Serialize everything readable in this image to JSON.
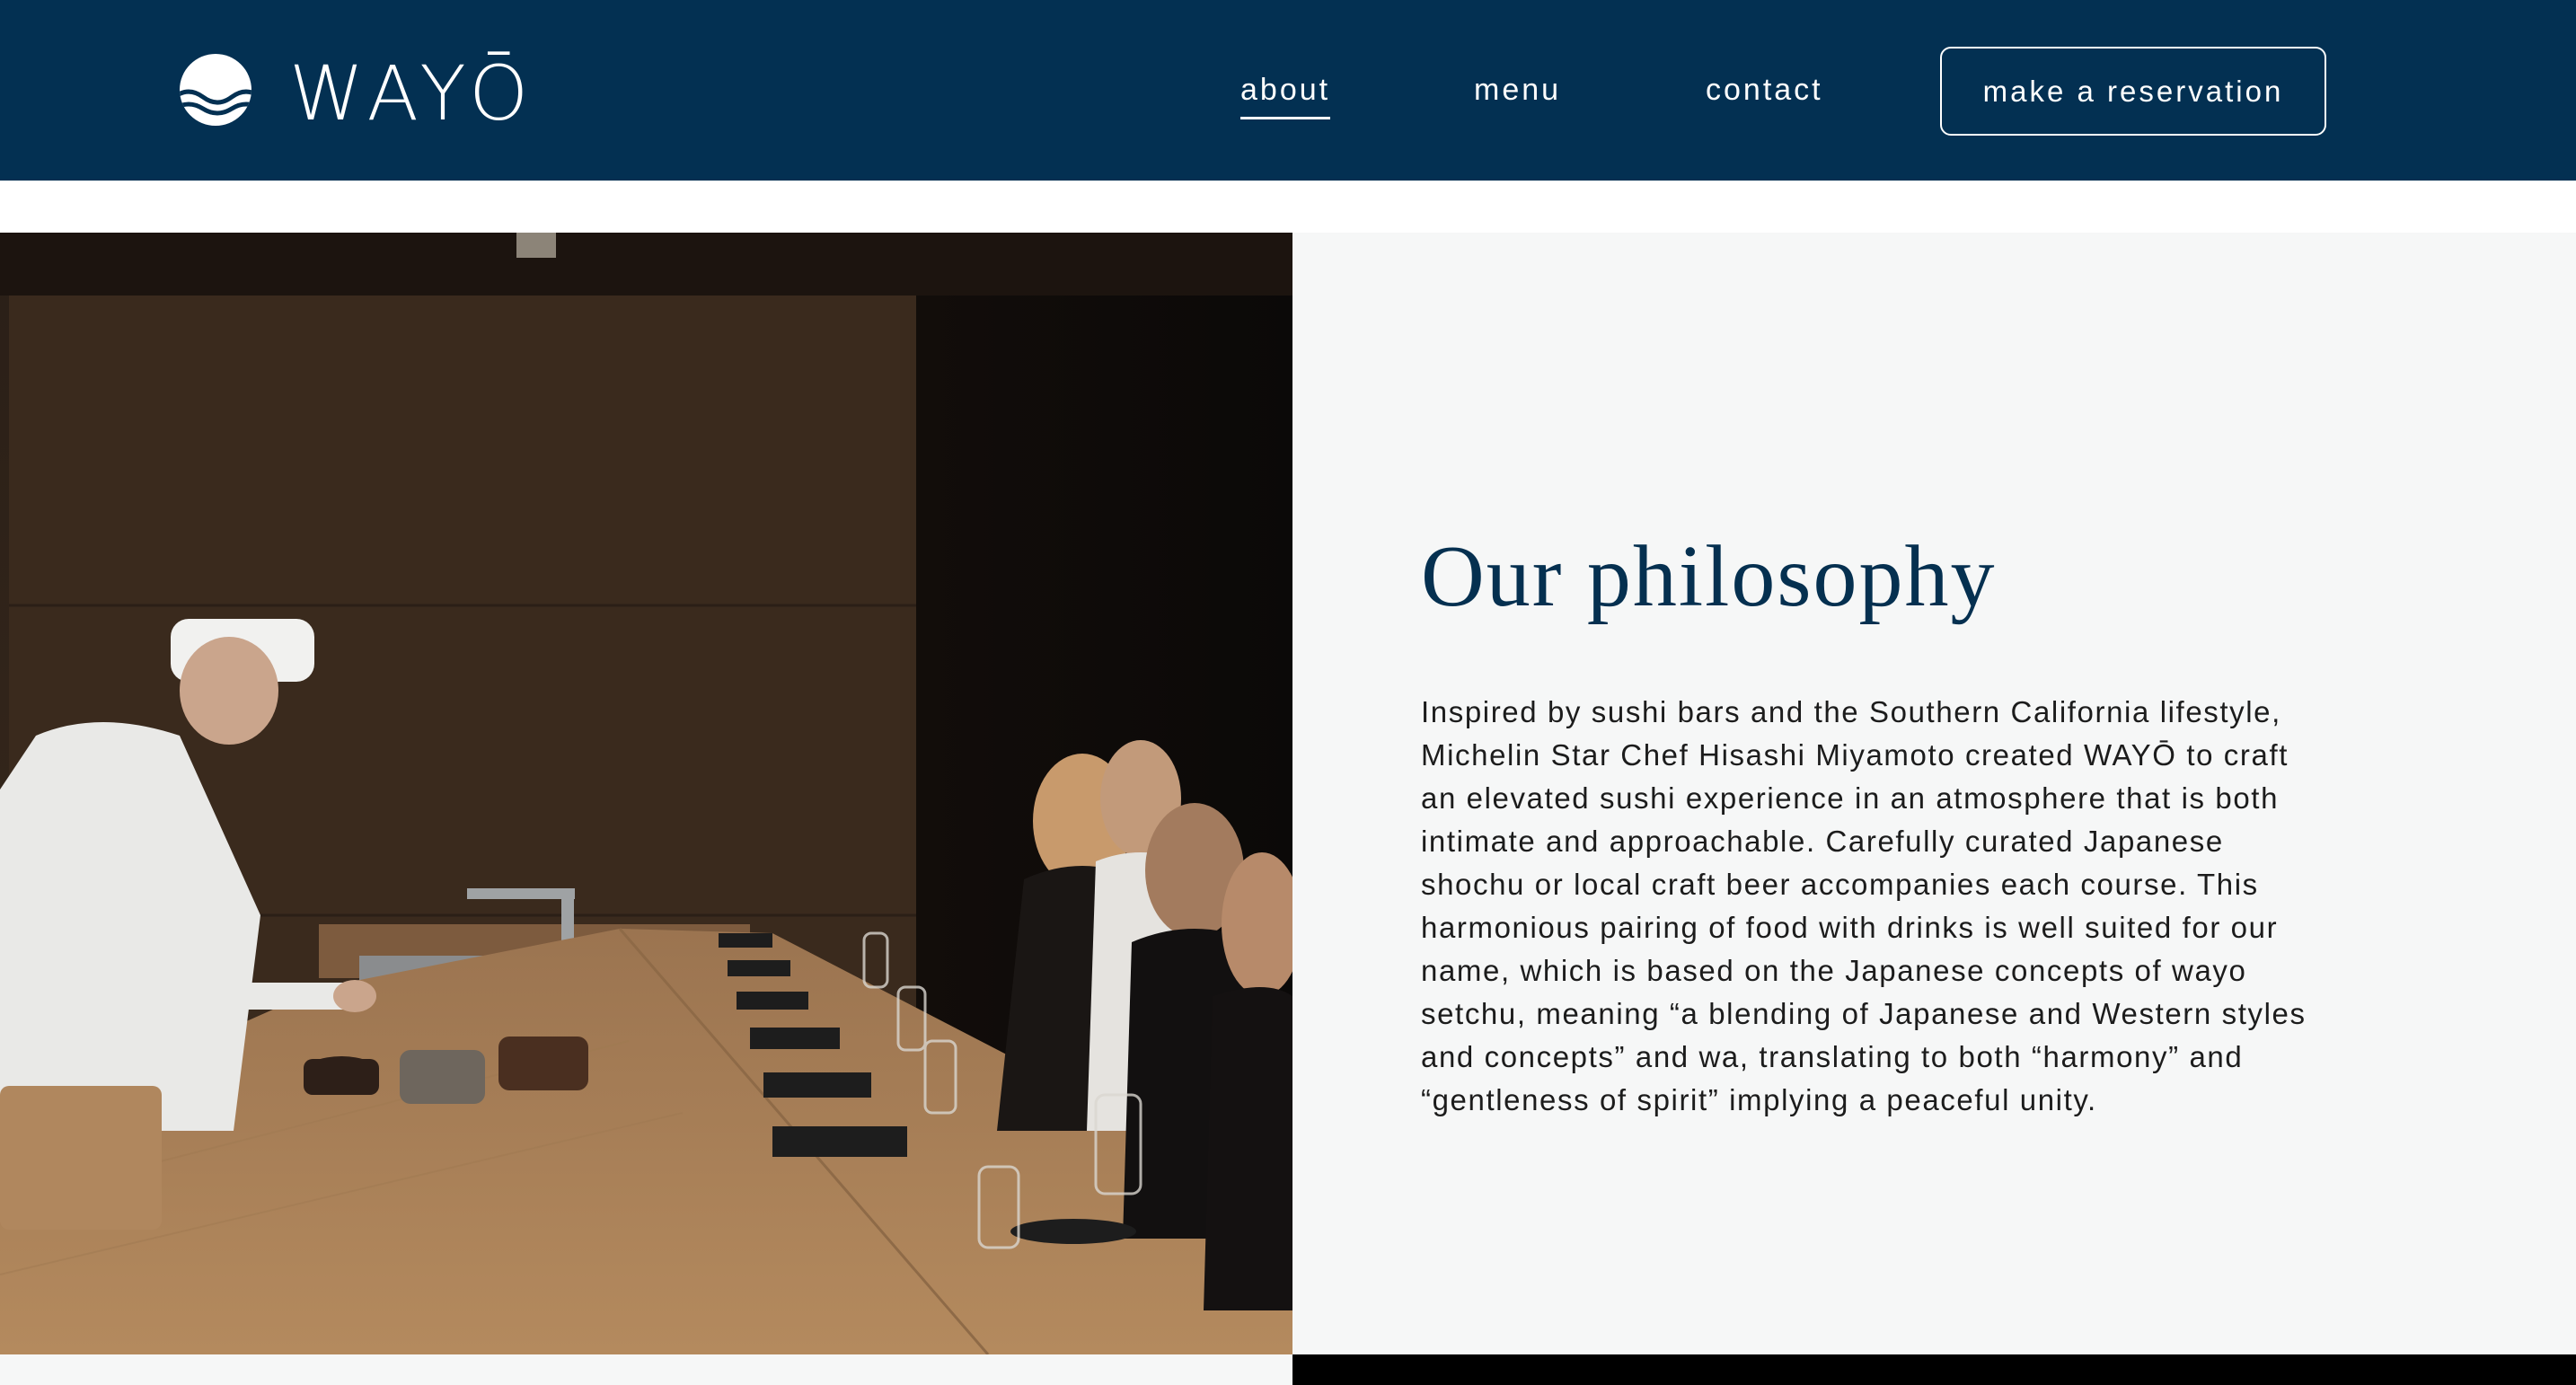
{
  "header": {
    "logo_text": "WAYŌ",
    "nav": [
      {
        "label": "about",
        "active": true
      },
      {
        "label": "menu",
        "active": false
      },
      {
        "label": "contact",
        "active": false
      }
    ],
    "cta_label": "make a reservation"
  },
  "hero_image": {
    "alt": "Sushi chef preparing food at a wooden counter while diners are seated along the bar"
  },
  "philosophy": {
    "title": "Our philosophy",
    "body_lines": [
      "Inspired by sushi bars and the Southern California lifestyle,",
      "Michelin Star Chef Hisashi Miyamoto created WAYŌ to craft",
      "an elevated sushi experience in an atmosphere that is both",
      "intimate and approachable. Carefully curated Japanese",
      "shochu or local craft beer accompanies each course. This",
      "harmonious pairing of food with drinks is well suited for our",
      "name, which is based on the Japanese concepts of wayo",
      "setchu, meaning “a blending of Japanese and Western styles",
      "and concepts” and wa, translating to both “harmony” and",
      "“gentleness of spirit” implying a peaceful unity."
    ]
  },
  "colors": {
    "brand_navy": "#033052",
    "title_navy": "#053050",
    "panel_bg": "#f6f7f7",
    "body_text": "#1c1c1c"
  }
}
